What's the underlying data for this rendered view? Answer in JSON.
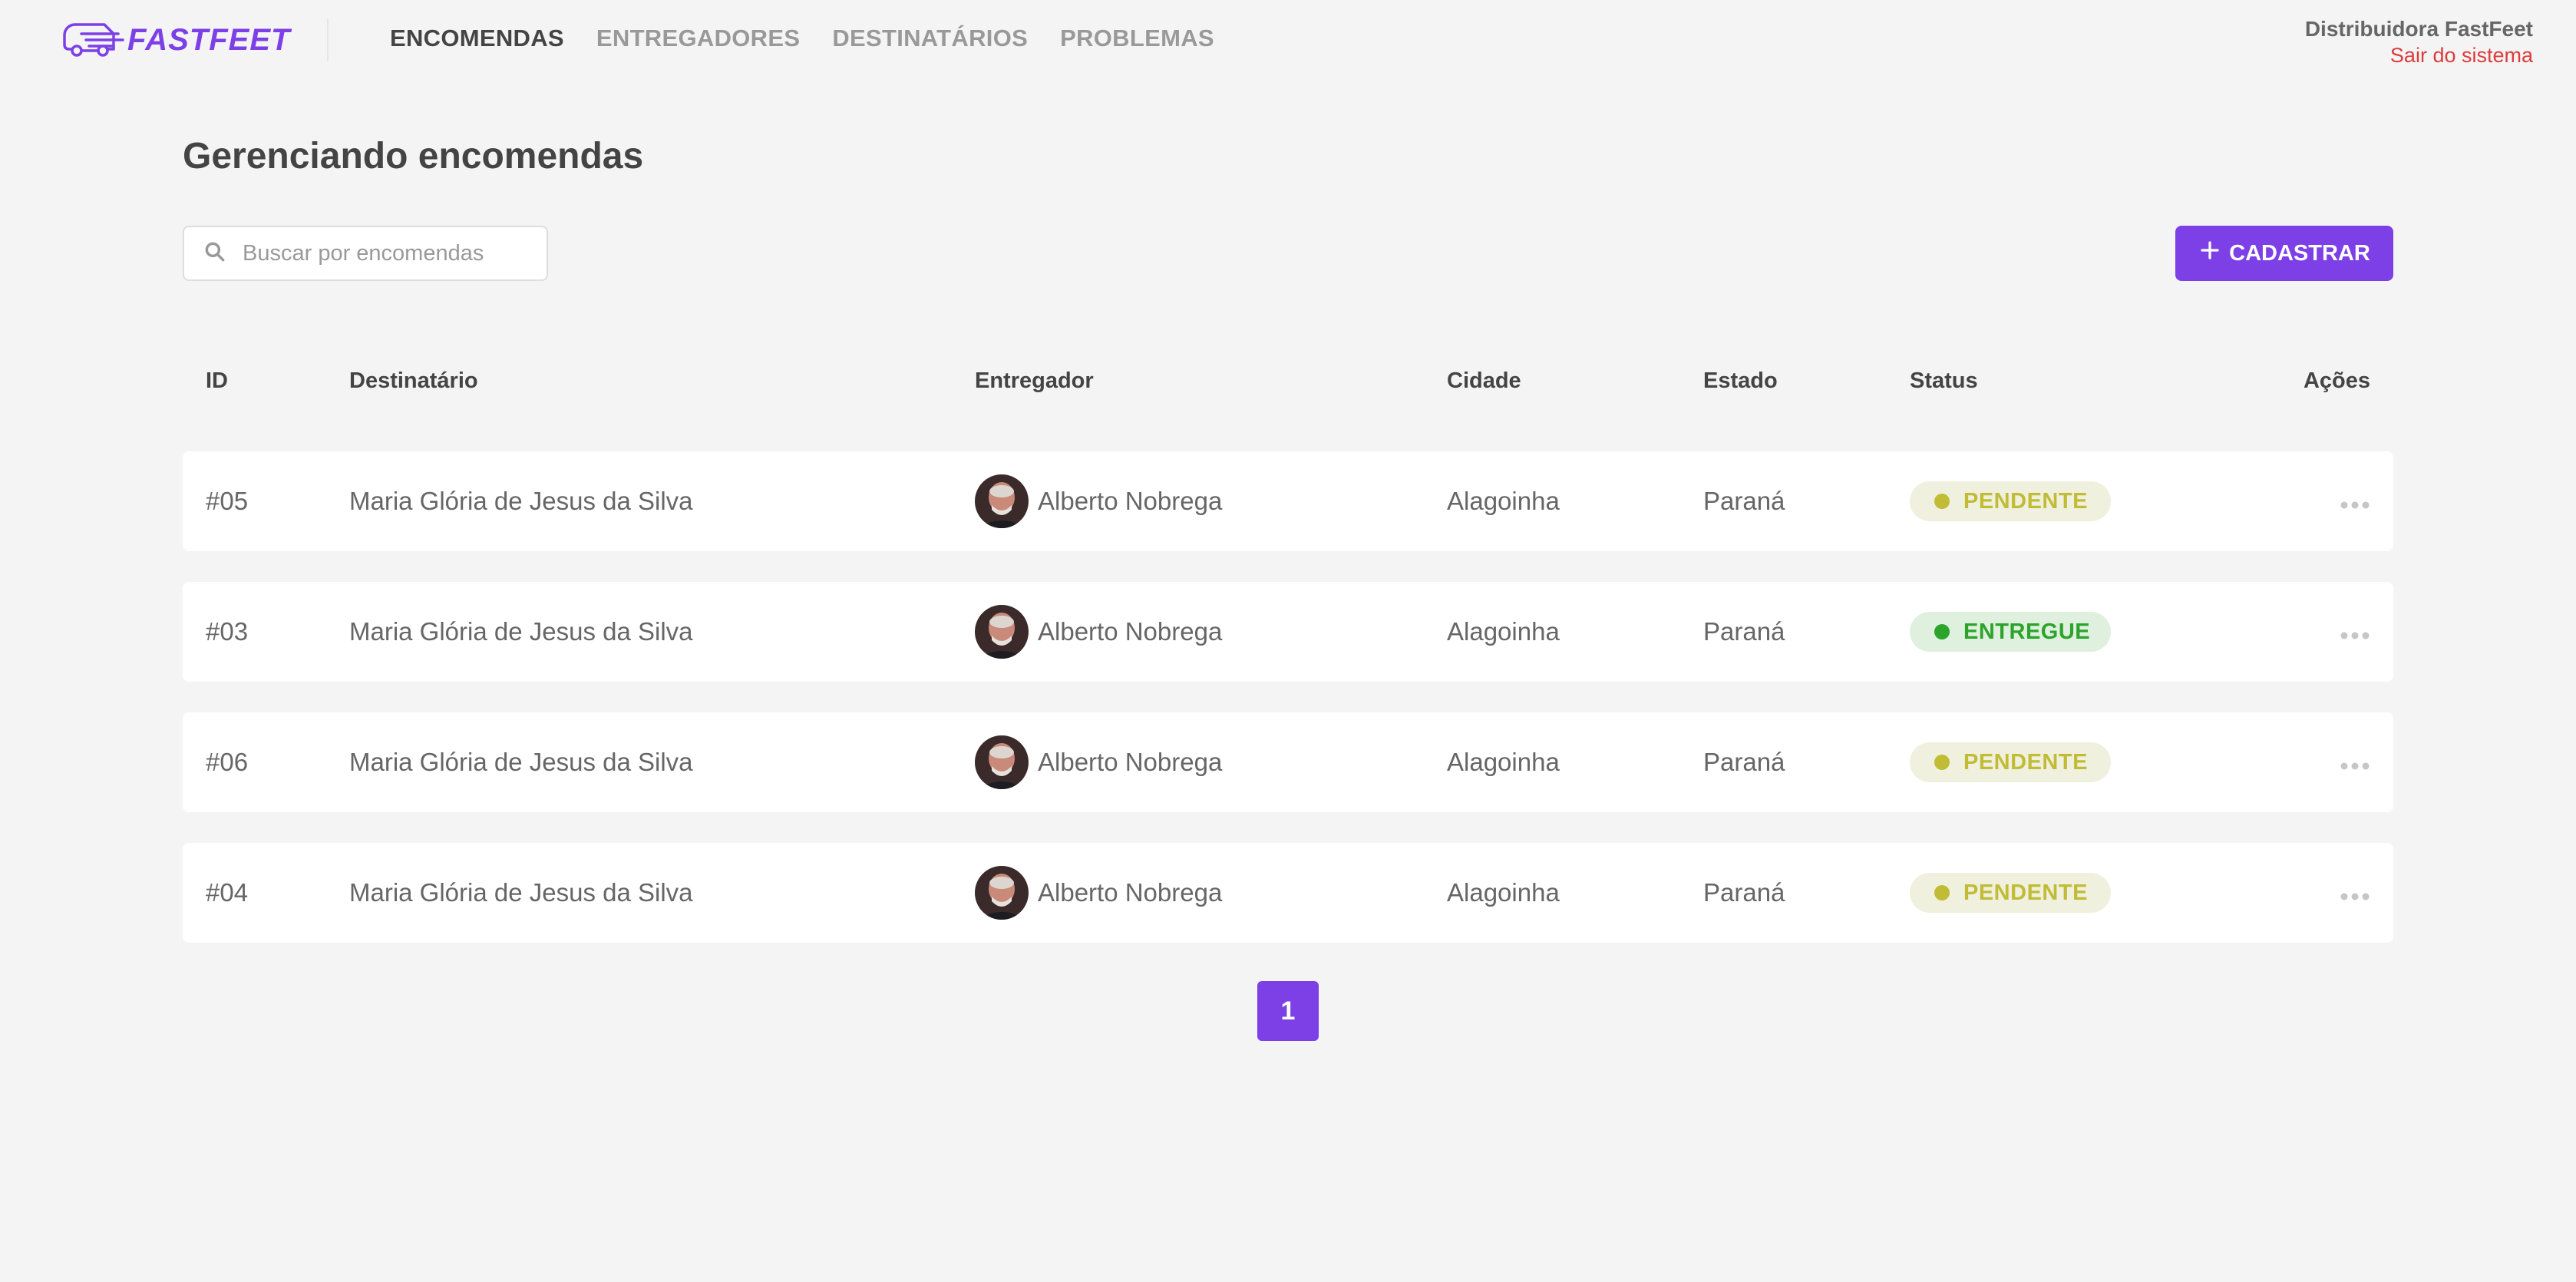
{
  "app": {
    "logo_text": "FASTFEET"
  },
  "nav": {
    "items": [
      {
        "label": "ENCOMENDAS",
        "active": true
      },
      {
        "label": "ENTREGADORES",
        "active": false
      },
      {
        "label": "DESTINATÁRIOS",
        "active": false
      },
      {
        "label": "PROBLEMAS",
        "active": false
      }
    ]
  },
  "user": {
    "name": "Distribuidora FastFeet",
    "logout_label": "Sair do sistema"
  },
  "main": {
    "title": "Gerenciando encomendas",
    "search": {
      "placeholder": "Buscar por encomendas",
      "value": ""
    },
    "add_button_label": "CADASTRAR"
  },
  "table": {
    "headers": {
      "id": "ID",
      "recipient": "Destinatário",
      "deliveryman": "Entregador",
      "city": "Cidade",
      "state": "Estado",
      "status": "Status",
      "actions": "Ações"
    },
    "rows": [
      {
        "id": "#05",
        "recipient": "Maria Glória de Jesus da Silva",
        "deliveryman": "Alberto Nobrega",
        "city": "Alagoinha",
        "state": "Paraná",
        "status": "PENDENTE"
      },
      {
        "id": "#03",
        "recipient": "Maria Glória de Jesus da Silva",
        "deliveryman": "Alberto Nobrega",
        "city": "Alagoinha",
        "state": "Paraná",
        "status": "ENTREGUE"
      },
      {
        "id": "#06",
        "recipient": "Maria Glória de Jesus da Silva",
        "deliveryman": "Alberto Nobrega",
        "city": "Alagoinha",
        "state": "Paraná",
        "status": "PENDENTE"
      },
      {
        "id": "#04",
        "recipient": "Maria Glória de Jesus da Silva",
        "deliveryman": "Alberto Nobrega",
        "city": "Alagoinha",
        "state": "Paraná",
        "status": "PENDENTE"
      }
    ]
  },
  "pagination": {
    "current_page": "1"
  },
  "colors": {
    "brand": "#7d40e7",
    "logout": "#de3b3b",
    "pending": "#c1bc35",
    "pending_bg": "#f0f0df",
    "delivered": "#2ca42b",
    "delivered_bg": "#dff0df"
  }
}
